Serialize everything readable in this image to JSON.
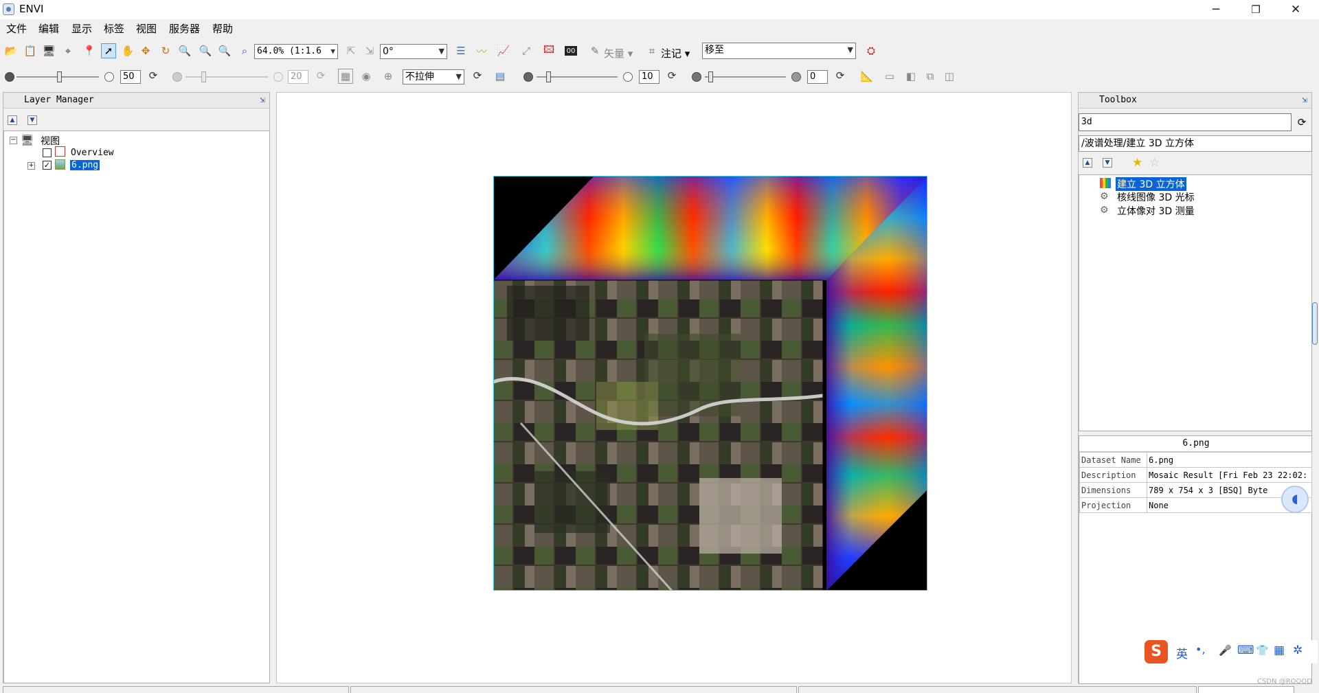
{
  "window": {
    "title": "ENVI",
    "minimize": "─",
    "maximize": "❐",
    "close": "✕"
  },
  "menu": [
    "文件",
    "编辑",
    "显示",
    "标签",
    "视图",
    "服务器",
    "帮助"
  ],
  "toolbar1": {
    "zoom_value": "64.0% (1:1.6",
    "rotation_value": "0°",
    "vector_label": "矢量",
    "annotation_label": "注记",
    "goto_value": "移至"
  },
  "toolbar2": {
    "brightness_value": "50",
    "transparency_value": "20",
    "stretch_value": "不拉伸",
    "sharpen_value": "10",
    "opacity_value": "0"
  },
  "layer_manager": {
    "title": "Layer Manager",
    "root_label": "视图",
    "items": [
      {
        "label": "Overview",
        "checked": false
      },
      {
        "label": "6.png",
        "checked": true,
        "selected": true
      }
    ]
  },
  "toolbox": {
    "title": "Toolbox",
    "search_value": "3d",
    "path": "/波谱处理/建立 3D 立方体",
    "results": [
      {
        "label": "建立 3D 立方体",
        "selected": true
      },
      {
        "label": "核线图像 3D 光标",
        "selected": false
      },
      {
        "label": "立体像对 3D 测量",
        "selected": false
      }
    ]
  },
  "metadata": {
    "title": "6.png",
    "rows": [
      {
        "key": "Dataset Name",
        "value": "6.png"
      },
      {
        "key": "Description",
        "value": "Mosaic Result [Fri Feb 23 22:02:"
      },
      {
        "key": "Dimensions",
        "value": "789 x 754 x 3 [BSQ] Byte"
      },
      {
        "key": "Projection",
        "value": "None"
      }
    ]
  },
  "ime_bar": {
    "logo": "S",
    "lang": "英",
    "punct": "•,",
    "mic": "🎤",
    "keyboard": "⌨",
    "skin": "👕",
    "apps": "▦",
    "settings": "✲"
  },
  "watermark": "CSDN @ROOOD"
}
